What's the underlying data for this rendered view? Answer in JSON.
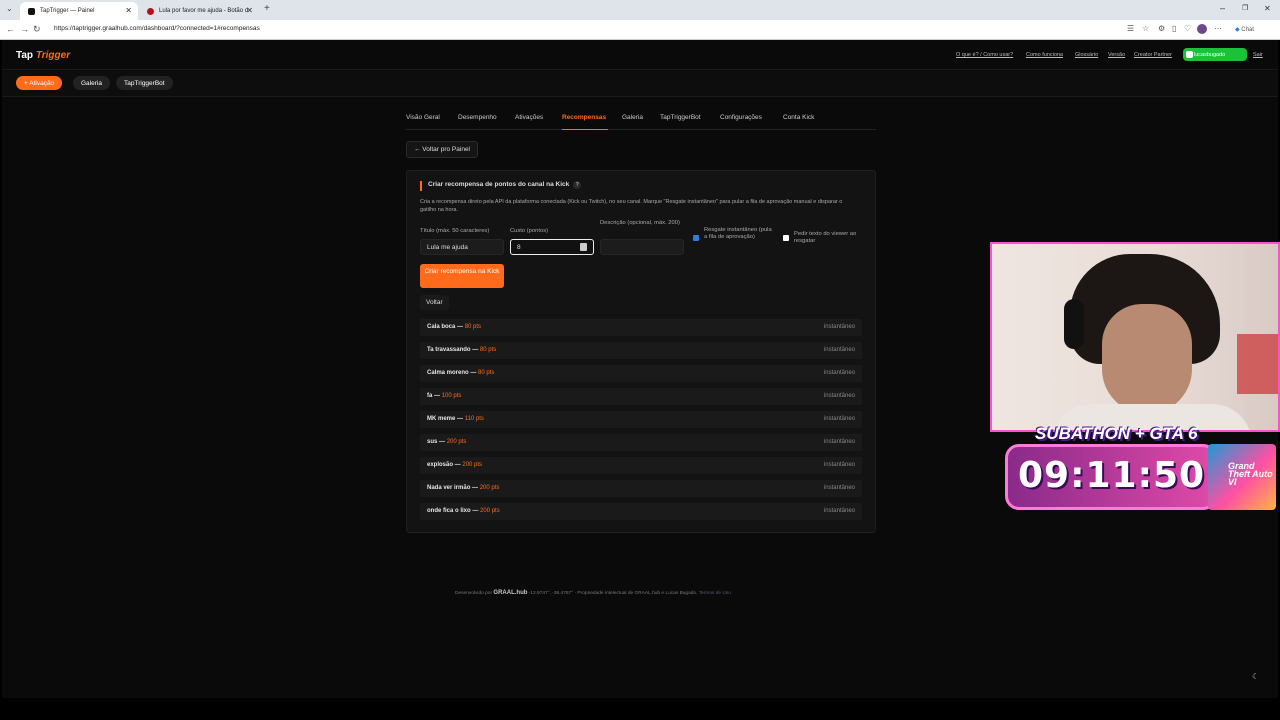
{
  "browser": {
    "tabs": [
      {
        "title": "TapTrigger — Painel",
        "active": true
      },
      {
        "title": "Lula por favor me ajuda - Botão d",
        "active": false
      }
    ],
    "url": "https://taptrigger.graalhub.com/dashboard/?connected=1#recompensas",
    "chat_label": "Chat"
  },
  "topbar": {
    "logo_a": "Tap",
    "logo_b": "Trigger",
    "links": [
      "O que é? / Como usar?",
      "Como funciona",
      "Glossário",
      "Versão",
      "Creator Partner"
    ],
    "user": "lucasbugado",
    "logout": "Sair"
  },
  "actionbar": {
    "activation": "+ Ativação",
    "gallery": "Galeria",
    "bot": "TapTriggerBot"
  },
  "tabs": [
    "Visão Geral",
    "Desempenho",
    "Ativações",
    "Recompensas",
    "Galeria",
    "TapTriggerBot",
    "Configurações",
    "Conta Kick"
  ],
  "active_tab": "Recompensas",
  "back_button": "← Voltar pro Painel",
  "panel": {
    "title": "Criar recompensa de pontos do canal na Kick",
    "help": "?",
    "description": "Cria a recompensa direto pela API da plataforma conectada (Kick ou Twitch), no seu canal. Marque \"Resgate instantâneo\" para pular a fila de aprovação manual e disparar o gatilho na hora.",
    "form": {
      "title_label": "Título (máx. 50 caracteres)",
      "title_value": "Lula me ajuda",
      "cost_label": "Custo (pontos)",
      "cost_value": "8",
      "desc_label": "Descrição (opcional, máx. 200)",
      "desc_value": "",
      "instant_label": "Resgate instantâneo (pula a fila de aprovação)",
      "instant_checked": true,
      "viewer_text_label": "Pedir texto do viewer ao resgatar",
      "viewer_text_checked": false
    },
    "create_button": "Criar recompensa na Kick",
    "back_label": "Voltar",
    "rewards": [
      {
        "name": "Cala boca",
        "pts": "80 pts",
        "tag": "instantâneo"
      },
      {
        "name": "Ta travassando",
        "pts": "80 pts",
        "tag": "instantâneo"
      },
      {
        "name": "Calma moreno",
        "pts": "80 pts",
        "tag": "instantâneo"
      },
      {
        "name": "fa",
        "pts": "100 pts",
        "tag": "instantâneo"
      },
      {
        "name": "MK meme",
        "pts": "110 pts",
        "tag": "instantâneo"
      },
      {
        "name": "sus",
        "pts": "200 pts",
        "tag": "instantâneo"
      },
      {
        "name": "explosão",
        "pts": "200 pts",
        "tag": "instantâneo"
      },
      {
        "name": "Nada ver irmão",
        "pts": "200 pts",
        "tag": "instantâneo"
      },
      {
        "name": "onde fica o lixo",
        "pts": "200 pts",
        "tag": "instantâneo"
      }
    ]
  },
  "footer": {
    "prefix": "Desenvolvido por",
    "brand": "GRAAL.hub",
    "coords": "-12.9747°, -38.4767°",
    "rights": "· Propriedade intelectual de GRAAL.hub e Lucas Bugado.",
    "link": "Termos de Uso"
  },
  "overlay": {
    "subathon_title": "SUBATHON + GTA 6",
    "timer": "09:11:50",
    "cover_label": "Grand Theft Auto VI"
  },
  "colors": {
    "accent": "#ff6b1a",
    "user_badge": "#19c236",
    "overlay_border": "#ff4fd0"
  }
}
